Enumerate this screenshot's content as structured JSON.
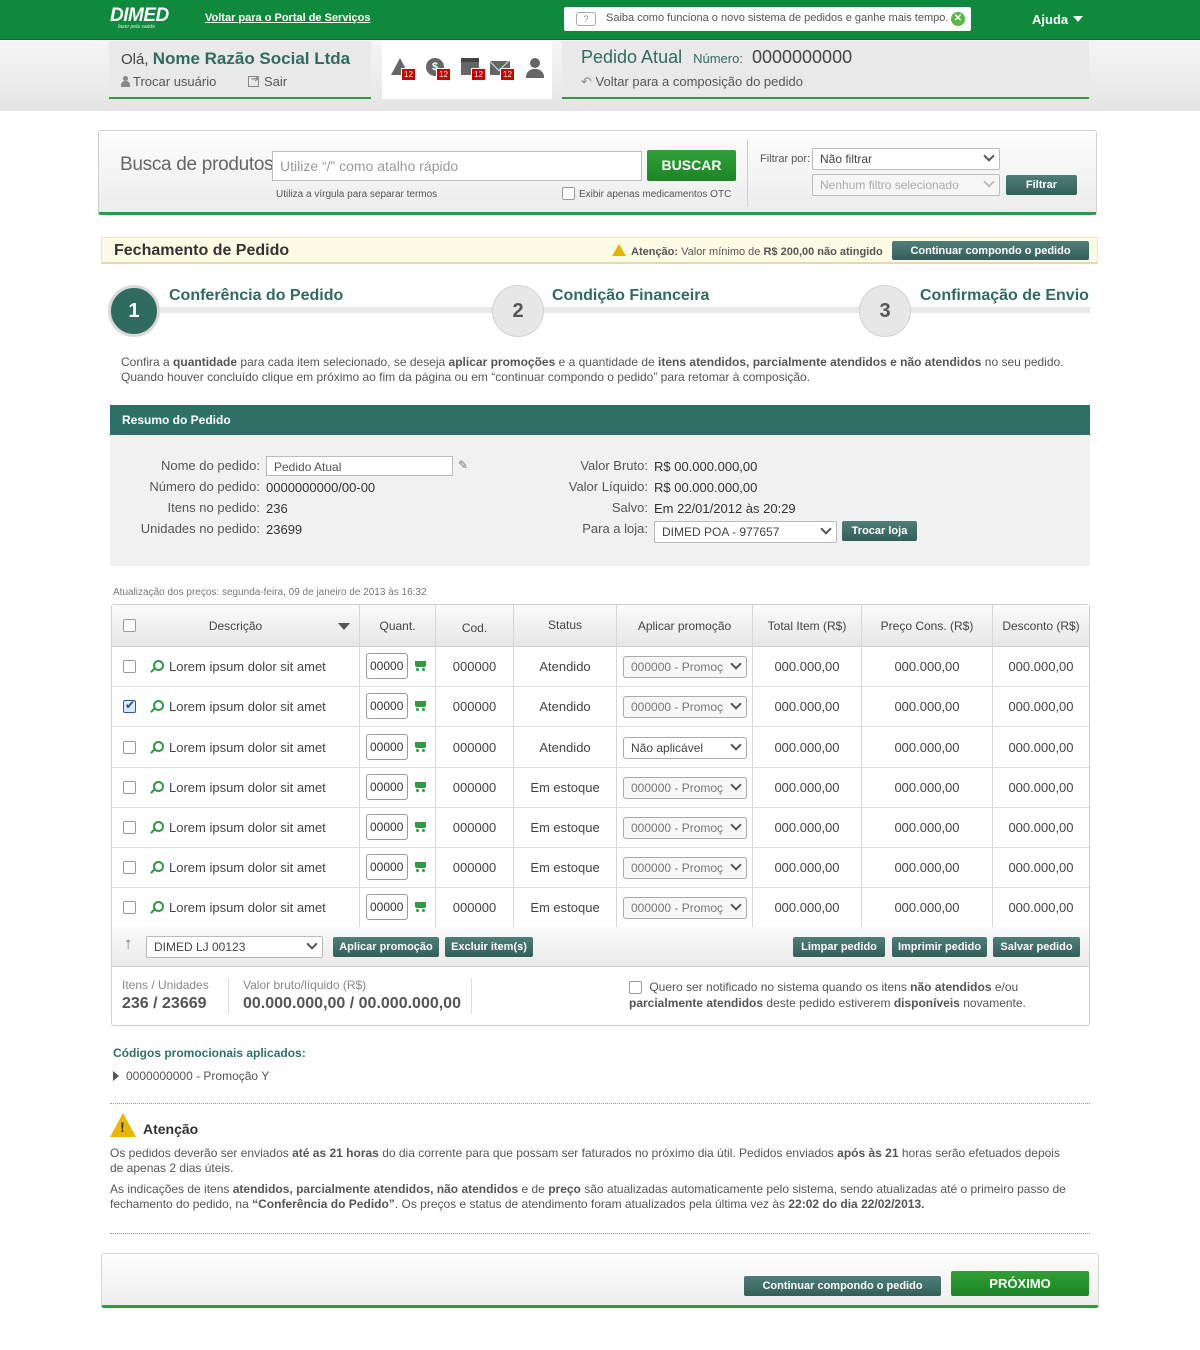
{
  "topbar": {
    "logo_text": "DIMED",
    "logo_tagline": "fazer pela saúde",
    "portal_link": "Voltar para o Portal de Serviços",
    "notice_text": "Saiba como funciona o novo sistema de pedidos e ganhe mais tempo.",
    "help_label": "Ajuda"
  },
  "user": {
    "greeting": "Olá,",
    "name": "Nome Razão Social Ltda",
    "switch_user": "Trocar usuário",
    "logout": "Sair"
  },
  "notifications": [
    {
      "icon": "warning-icon",
      "count": "12"
    },
    {
      "icon": "money-icon",
      "count": "12"
    },
    {
      "icon": "calendar-icon",
      "count": "12"
    },
    {
      "icon": "mail-icon",
      "count": "12"
    },
    {
      "icon": "profile-icon",
      "count": ""
    }
  ],
  "order_header": {
    "title": "Pedido Atual",
    "number_label": "Número:",
    "number": "0000000000",
    "back_link": "Voltar para a composição do pedido"
  },
  "search": {
    "title": "Busca de produtos",
    "placeholder": "Utilize “/” como atalho rápido",
    "button": "BUSCAR",
    "hint": "Utiliza a vírgula para separar termos",
    "otc_label": "Exibir apenas medicamentos OTC",
    "filter_label": "Filtrar por:",
    "filter_value": "Não filtrar",
    "filter2_value": "Nenhum filtro selecionado",
    "filter_button": "Filtrar"
  },
  "closing": {
    "title": "Fechamento de Pedido",
    "warn_label": "Atenção:",
    "warn_text_1": "Valor mínimo de",
    "warn_value": "R$ 200,00 não atingido",
    "continue_button": "Continuar compondo o pedido"
  },
  "steps": [
    {
      "number": "1",
      "label": "Conferência do Pedido",
      "active": true
    },
    {
      "number": "2",
      "label": "Condição Financeira",
      "active": false
    },
    {
      "number": "3",
      "label": "Confirmação de Envio",
      "active": false
    }
  ],
  "intro": {
    "p1_a": "Confira a",
    "p1_b": "quantidade",
    "p1_c": "para cada item selecionado, se deseja",
    "p1_d": "aplicar promoções",
    "p1_e": "e a quantidade de",
    "p1_f": "itens atendidos, parcialmente atendidos e não atendidos",
    "p1_g": "no seu pedido.",
    "p2": "Quando houver concluído clique em próximo ao fim da página ou em “continuar compondo o pedido” para retomar à composição."
  },
  "summary": {
    "header": "Resumo do Pedido",
    "name_label": "Nome do pedido:",
    "name_value": "Pedido Atual",
    "number_label": "Número do pedido:",
    "number_value": "0000000000/00-00",
    "items_label": "Itens no pedido:",
    "items_value": "236",
    "units_label": "Unidades no pedido:",
    "units_value": "23699",
    "gross_label": "Valor Bruto:",
    "gross_value": "R$ 00.000.000,00",
    "net_label": "Valor Líquido:",
    "net_value": "R$ 00.000.000,00",
    "saved_label": "Salvo:",
    "saved_value": "Em 22/01/2012 às 20:29",
    "store_label": "Para a loja:",
    "store_value": "DIMED POA - 977657",
    "store_button": "Trocar loja"
  },
  "table": {
    "updated": "Atualização dos preços: segunda-feira, 09 de janeiro de 2013 às 16:32",
    "headers": [
      "Descrição",
      "Quant.",
      "Cod.",
      "Status",
      "Aplicar promoção",
      "Total Item (R$)",
      "Preço Cons. (R$)",
      "Desconto (R$)"
    ],
    "rows": [
      {
        "checked": false,
        "desc": "Lorem ipsum dolor sit amet",
        "qty": "00000",
        "cod": "000000",
        "status": "Atendido",
        "promo": "000000 - Promoç",
        "total": "000.000,00",
        "price": "000.000,00",
        "discount": "000.000,00"
      },
      {
        "checked": true,
        "desc": "Lorem ipsum dolor sit amet",
        "qty": "00000",
        "cod": "000000",
        "status": "Atendido",
        "promo": "000000 - Promoç",
        "total": "000.000,00",
        "price": "000.000,00",
        "discount": "000.000,00"
      },
      {
        "checked": false,
        "desc": "Lorem ipsum dolor sit amet",
        "qty": "00000",
        "cod": "000000",
        "status": "Atendido",
        "promo": "Não aplicável",
        "total": "000.000,00",
        "price": "000.000,00",
        "discount": "000.000,00"
      },
      {
        "checked": false,
        "desc": "Lorem ipsum dolor sit amet",
        "qty": "00000",
        "cod": "000000",
        "status": "Em estoque",
        "promo": "000000 - Promoç",
        "total": "000.000,00",
        "price": "000.000,00",
        "discount": "000.000,00"
      },
      {
        "checked": false,
        "desc": "Lorem ipsum dolor sit amet",
        "qty": "00000",
        "cod": "000000",
        "status": "Em estoque",
        "promo": "000000 - Promoç",
        "total": "000.000,00",
        "price": "000.000,00",
        "discount": "000.000,00"
      },
      {
        "checked": false,
        "desc": "Lorem ipsum dolor sit amet",
        "qty": "00000",
        "cod": "000000",
        "status": "Em estoque",
        "promo": "000000 - Promoç",
        "total": "000.000,00",
        "price": "000.000,00",
        "discount": "000.000,00"
      },
      {
        "checked": false,
        "desc": "Lorem ipsum dolor sit amet",
        "qty": "00000",
        "cod": "000000",
        "status": "Em estoque",
        "promo": "000000 - Promoç",
        "total": "000.000,00",
        "price": "000.000,00",
        "discount": "000.000,00"
      }
    ],
    "footer": {
      "store_select": "DIMED LJ 00123",
      "apply_promo": "Aplicar promoção",
      "delete_items": "Excluir item(s)",
      "clear": "Limpar pedido",
      "print": "Imprimir pedido",
      "save": "Salvar pedido"
    },
    "totals": {
      "items_label": "Itens / Unidades",
      "items_value": "236 / 23669",
      "value_label": "Valor bruto/líquido (R$)",
      "value_value": "00.000.000,00 / 00.000.000,00"
    },
    "notify": {
      "a": "Quero ser notificado no sistema quando os itens",
      "b": "não atendidos",
      "c": "e/ou",
      "d": "parcialmente atendidos",
      "e": "deste pedido estiverem",
      "f": "disponíveis",
      "g": "novamente."
    }
  },
  "promo_codes": {
    "title": "Códigos promocionais aplicados:",
    "item": "0000000000 - Promoção Y"
  },
  "attention": {
    "title": "Atenção",
    "p1_a": "Os pedidos deverão ser enviados",
    "p1_b": "até as 21 horas",
    "p1_c": "do dia corrente para que possam ser faturados no próximo dia útil. Pedidos enviados",
    "p1_d": "após às 21",
    "p1_e": "horas serão efetuados depois",
    "p1_f": "de apenas 2 dias úteis.",
    "p2_a": "As indicações de itens",
    "p2_b": "atendidos, parcialmente atendidos, não atendidos",
    "p2_c": "e de",
    "p2_d": "preço",
    "p2_e": "são atualizadas automaticamente pelo sistema, sendo atualizadas até o primeiro passo de",
    "p2_f": "fechamento do pedido, na",
    "p2_g": "“Conferência do Pedido”",
    "p2_h": ". Os preços e status de atendimento foram atualizados pela última vez às",
    "p2_i": "22:02 do dia 22/02/2013."
  },
  "bottom": {
    "continue_button": "Continuar compondo o pedido",
    "next_button": "PRÓXIMO"
  },
  "colors": {
    "brand_green": "#0f8a3c",
    "teal": "#2f7066",
    "button_green": "#2fa035"
  }
}
